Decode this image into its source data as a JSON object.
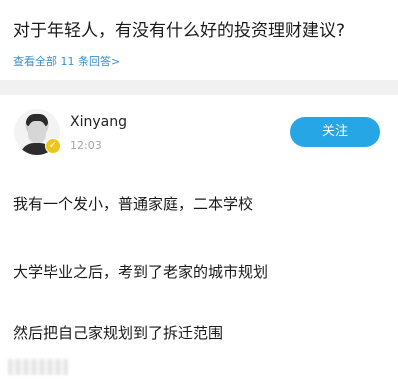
{
  "question": {
    "title": "对于年轻人，有没有什么好的投资理财建议?",
    "view_all": "查看全部 11 条回答>"
  },
  "answer": {
    "author": "Xinyang",
    "time": "12:03",
    "follow_label": "关注",
    "paragraphs": [
      "我有一个发小，普通家庭，二本学校",
      "大学毕业之后，考到了老家的城市规划",
      "然后把自己家规划到了拆迁范围"
    ]
  },
  "colors": {
    "accent": "#27a6e6",
    "link": "#3b8fd0",
    "badge": "#f0c419"
  },
  "icons": {
    "verified": "verified-badge-icon"
  }
}
